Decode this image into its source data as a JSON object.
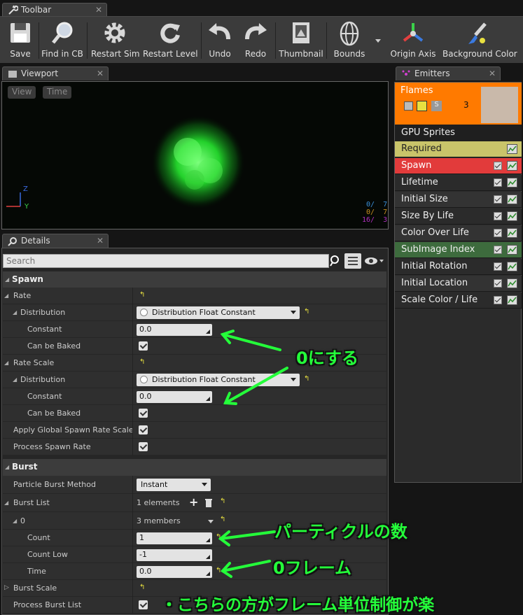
{
  "toolbar_tab": {
    "title": "Toolbar"
  },
  "toolbar": {
    "save": "Save",
    "find_in_cb": "Find in CB",
    "restart_sim": "Restart Sim",
    "restart_level": "Restart Level",
    "undo": "Undo",
    "redo": "Redo",
    "thumbnail": "Thumbnail",
    "bounds": "Bounds",
    "origin_axis": "Origin Axis",
    "background_color": "Background Color"
  },
  "viewport_tab": {
    "title": "Viewport"
  },
  "viewport": {
    "view_button": "View",
    "time_button": "Time",
    "axis_z": "Z",
    "axis_y": "Y",
    "stats": [
      {
        "a": "0/",
        "b": "7",
        "color": "#3a8fd8"
      },
      {
        "a": "0/",
        "b": "7",
        "color": "#c89020"
      },
      {
        "a": "16/",
        "b": "3",
        "color": "#b030c0"
      }
    ]
  },
  "details_tab": {
    "title": "Details"
  },
  "details": {
    "search_placeholder": "Search",
    "spawn_header": "Spawn",
    "rate": "Rate",
    "distribution": "Distribution",
    "distribution_value": "Distribution Float Constant",
    "constant": "Constant",
    "constant_value": "0.0",
    "can_be_baked": "Can be Baked",
    "rate_scale": "Rate Scale",
    "distribution2": "Distribution",
    "distribution2_value": "Distribution Float Constant",
    "constant2": "Constant",
    "constant2_value": "0.0",
    "can_be_baked2": "Can be Baked",
    "apply_global": "Apply Global Spawn Rate Scale",
    "process_spawn_rate": "Process Spawn Rate",
    "burst_header": "Burst",
    "particle_burst_method": "Particle Burst Method",
    "burst_method_value": "Instant",
    "burst_list": "Burst List",
    "burst_list_value": "1 elements",
    "item0": "0",
    "item0_value": "3 members",
    "count": "Count",
    "count_value": "1",
    "count_low": "Count Low",
    "count_low_value": "-1",
    "time": "Time",
    "time_value": "0.0",
    "burst_scale": "Burst Scale",
    "process_burst_list": "Process Burst List"
  },
  "emitters_tab": {
    "title": "Emitters"
  },
  "emitters": {
    "emitter_name": "Flames",
    "emitter_count": "3",
    "solo_label": "S",
    "type": "GPU Sprites",
    "modules": [
      {
        "name": "Required",
        "color": "#c9c46a",
        "text": "#222"
      },
      {
        "name": "Spawn",
        "color": "#e23b3b",
        "text": "#fff"
      },
      {
        "name": "Lifetime",
        "color": "#2b2b2b",
        "text": "#eee"
      },
      {
        "name": "Initial Size",
        "color": "#333333",
        "text": "#eee"
      },
      {
        "name": "Size By Life",
        "color": "#2b2b2b",
        "text": "#eee"
      },
      {
        "name": "Color Over Life",
        "color": "#333333",
        "text": "#eee"
      },
      {
        "name": "SubImage Index",
        "color": "#3d6b3d",
        "text": "#eee"
      },
      {
        "name": "Initial Rotation",
        "color": "#2b2b2b",
        "text": "#eee"
      },
      {
        "name": "Initial Location",
        "color": "#333333",
        "text": "#eee"
      },
      {
        "name": "Scale Color / Life",
        "color": "#2b2b2b",
        "text": "#eee"
      }
    ]
  },
  "annotations": {
    "set_zero": "0にする",
    "particle_count": "パーティクルの数",
    "zero_frame": "0フレーム",
    "frame_control": "・こちらの方がフレーム単位制御が楽"
  },
  "colors": {
    "annotation": "#24ff3a",
    "emitter_header": "#ff7a00",
    "reset_arrow": "#e8e040"
  }
}
